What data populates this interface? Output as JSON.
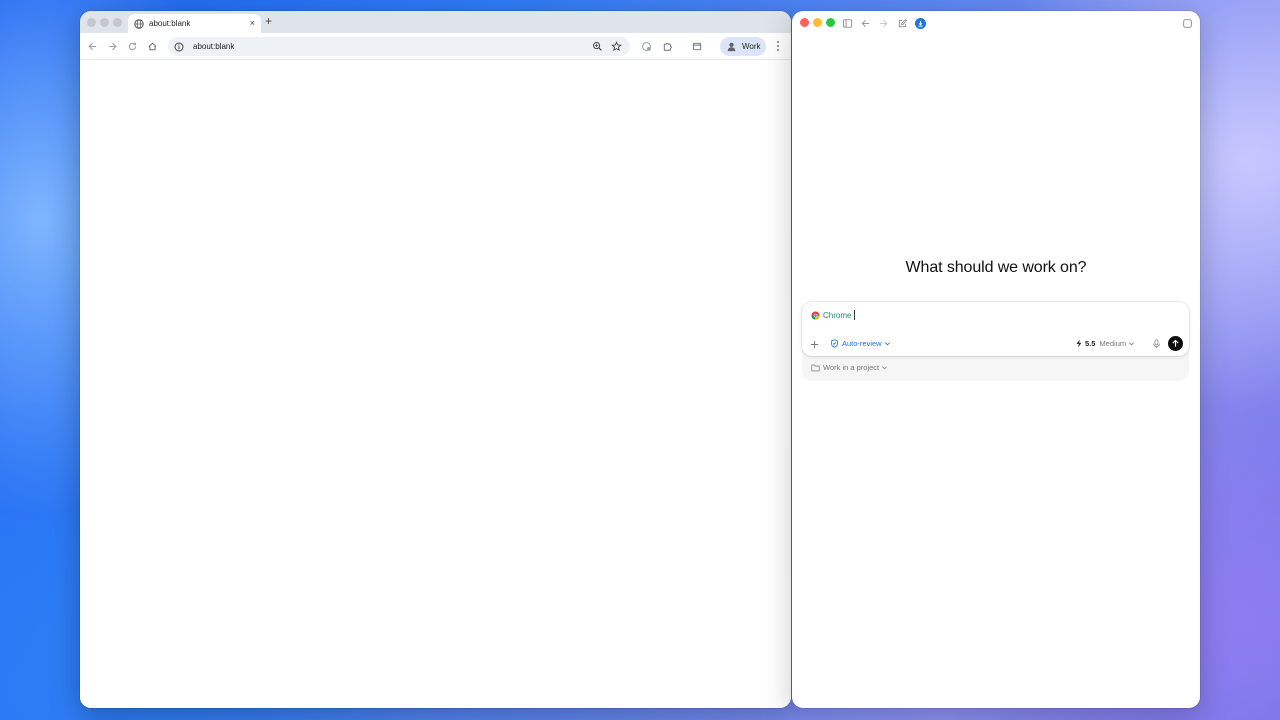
{
  "browser": {
    "tab": {
      "title": "about:blank",
      "close_glyph": "×",
      "icon": "globe-icon"
    },
    "new_tab_glyph": "+",
    "toolbar": {
      "icons": [
        "back-icon",
        "forward-icon",
        "reload-icon",
        "home-icon",
        "zoom-icon",
        "bookmark-star-icon",
        "extension-puzzle-icon",
        "tab-search-icon",
        "menu-icon"
      ]
    },
    "omnibox": {
      "url": "about:blank",
      "icon": "info-icon"
    },
    "profile": {
      "label": "Work"
    }
  },
  "assistant": {
    "heading": "What should we work on?",
    "composer": {
      "context_chip": "Chrome",
      "permission_mode": "Auto-review",
      "model_version": "5.5",
      "effort": "Medium"
    },
    "project_selector": "Work in a project"
  },
  "colors": {
    "accent_blue": "#1a73e8",
    "chip_green": "#1a8a6e",
    "send_button": "#0d0d0d",
    "traffic_red": "#ff5f57",
    "traffic_yellow": "#febc2e",
    "traffic_green": "#28c840"
  }
}
